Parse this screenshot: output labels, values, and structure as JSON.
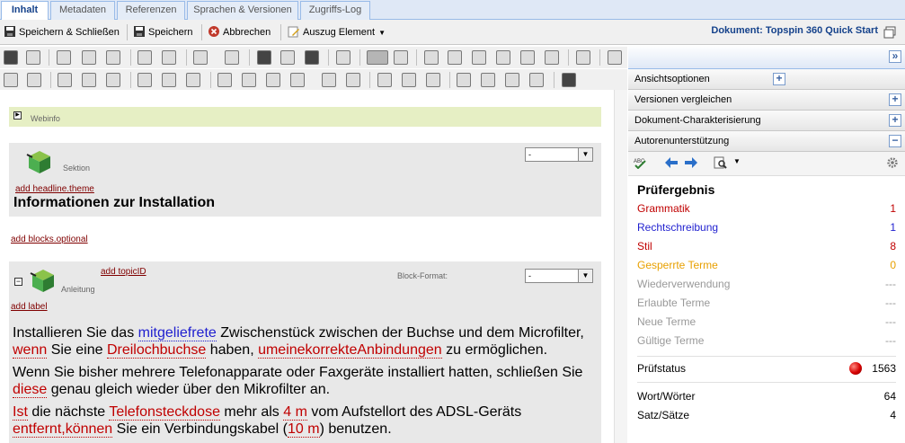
{
  "tabs": [
    "Inhalt",
    "Metadaten",
    "Referenzen",
    "Sprachen & Versionen",
    "Zugriffs-Log"
  ],
  "actions": {
    "save_close": "Speichern & Schließen",
    "save": "Speichern",
    "cancel": "Abbrechen",
    "extract": "Auszug Element"
  },
  "document_title": "Dokument: Topspin 360 Quick Start",
  "toolbar_icons_row1": [
    "print-icon",
    "print-preview-icon",
    "cut-icon",
    "copy-icon",
    "paste-icon",
    "undo-icon",
    "redo-icon",
    "check-icon",
    "spellcheck-icon",
    "find-icon",
    "find-replace-icon",
    "find-next-icon",
    "insert-object-icon",
    "markup-toggle-icon",
    "text-clear-icon",
    "table-insert-icon",
    "row-before-icon",
    "row-after-icon",
    "col-before-icon",
    "col-after-icon",
    "delete-row-icon",
    "entity-icon"
  ],
  "toolbar_icons_row2": [
    "table-icon",
    "table-props-icon",
    "cell-props-icon",
    "row-props-icon",
    "merge-cells-icon",
    "split-cells-icon",
    "join-icon",
    "join2-icon",
    "join3-icon",
    "join4-icon",
    "split-icon",
    "split2-icon",
    "valign-top-icon",
    "valign-middle-icon",
    "valign-bottom-icon",
    "align-left-icon",
    "align-center-icon",
    "align-right-icon",
    "align-justify-icon",
    "table-grid-icon"
  ],
  "editor": {
    "webinfo_label": "Webinfo",
    "section_label": "Sektion",
    "section_select": "-",
    "add_headline": "add headline.theme",
    "headline": "Informationen zur Installation",
    "add_blocks": "add blocks.optional",
    "add_topic": "add topicID",
    "block_format_label": "Block-Format:",
    "block_select": "-",
    "anleitung_label": "Anleitung",
    "add_label": "add label",
    "p1": [
      {
        "t": "Installieren Sie das ",
        "c": ""
      },
      {
        "t": "mitgeliefrete",
        "c": "bl"
      },
      {
        "t": " Zwischenstück zwischen der Buchse und dem Microfilter, ",
        "c": ""
      },
      {
        "t": "wenn",
        "c": "rd"
      },
      {
        "t": " Sie eine ",
        "c": ""
      },
      {
        "t": "Dreilochbuchse",
        "c": "rd"
      },
      {
        "t": " haben, ",
        "c": ""
      },
      {
        "t": "umeinekorrekteAnbindungen",
        "c": "rd"
      },
      {
        "t": " zu ermöglichen.",
        "c": ""
      }
    ],
    "p2": [
      {
        "t": "Wenn Sie bisher mehrere Telefonapparate oder Faxgeräte installiert hatten, schließen Sie ",
        "c": ""
      },
      {
        "t": "diese",
        "c": "rd"
      },
      {
        "t": " genau gleich wieder über den Mikrofilter an.",
        "c": ""
      }
    ],
    "p3": [
      {
        "t": "Ist",
        "c": "rd"
      },
      {
        "t": " die nächste ",
        "c": ""
      },
      {
        "t": "Telefonsteckdose",
        "c": "rd"
      },
      {
        "t": " mehr als ",
        "c": ""
      },
      {
        "t": "4 m",
        "c": "rd"
      },
      {
        "t": " vom Aufstellort des ADSL-Geräts ",
        "c": ""
      },
      {
        "t": "entfernt,können",
        "c": "rd"
      },
      {
        "t": " Sie ein Verbindungskabel (",
        "c": ""
      },
      {
        "t": "10 m",
        "c": "rd"
      },
      {
        "t": ") benutzen.",
        "c": ""
      }
    ]
  },
  "right_panel": {
    "accordion": [
      {
        "label": "Ansichtsoptionen",
        "state": "+"
      },
      {
        "label": "Versionen vergleichen",
        "state": "+"
      },
      {
        "label": "Dokument-Charakterisierung",
        "state": "+"
      },
      {
        "label": "Autorenunterstützung",
        "state": "−"
      }
    ],
    "collapse_glyph": "»",
    "result_title": "Prüfergebnis",
    "results": [
      {
        "label": "Grammatik",
        "value": "1",
        "color": "#c00000"
      },
      {
        "label": "Rechtschreibung",
        "value": "1",
        "color": "#1f1fcf"
      },
      {
        "label": "Stil",
        "value": "8",
        "color": "#c00000"
      },
      {
        "label": "Gesperrte Terme",
        "value": "0",
        "color": "#e8a000"
      },
      {
        "label": "Wiederverwendung",
        "value": "---",
        "color": "#999999"
      },
      {
        "label": "Erlaubte Terme",
        "value": "---",
        "color": "#999999"
      },
      {
        "label": "Neue Terme",
        "value": "---",
        "color": "#999999"
      },
      {
        "label": "Gültige Terme",
        "value": "---",
        "color": "#999999"
      }
    ],
    "status_label": "Prüfstatus",
    "status_value": "1563",
    "word_label": "Wort/Wörter",
    "word_value": "64",
    "sentence_label": "Satz/Sätze",
    "sentence_value": "4"
  }
}
